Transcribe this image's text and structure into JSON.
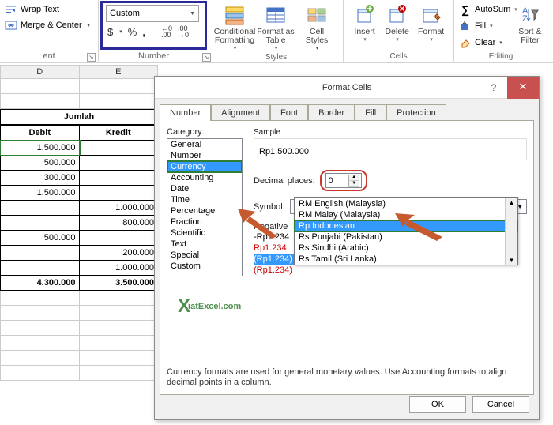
{
  "ribbon": {
    "alignment": {
      "wrap": "Wrap Text",
      "merge": "Merge & Center",
      "group": "ent"
    },
    "number": {
      "format": "Custom",
      "group": "Number",
      "btns": {
        "dollar": "$",
        "percent": "%",
        "comma": ",",
        "inc": "←0\n.00",
        "dec": ".00\n→0"
      }
    },
    "styles": {
      "cond": "Conditional\nFormatting",
      "table": "Format as\nTable",
      "cell": "Cell\nStyles",
      "group": "Styles"
    },
    "cells": {
      "insert": "Insert",
      "delete": "Delete",
      "format": "Format",
      "group": "Cells"
    },
    "editing": {
      "sum": "AutoSum",
      "fill": "Fill",
      "clear": "Clear",
      "sort": "Sort &\nFilter",
      "group": "Editing"
    }
  },
  "sheet": {
    "cols": [
      "D",
      "E"
    ],
    "header1": "Jumlah",
    "header2": [
      "Debit",
      "Kredit"
    ],
    "rows": [
      [
        "1.500.000",
        ""
      ],
      [
        "500.000",
        ""
      ],
      [
        "300.000",
        ""
      ],
      [
        "1.500.000",
        ""
      ],
      [
        "",
        "1.000.000"
      ],
      [
        "",
        "800.000"
      ],
      [
        "500.000",
        ""
      ],
      [
        "",
        "200.000"
      ],
      [
        "",
        "1.000.000"
      ]
    ],
    "totals": [
      "4.300.000",
      "3.500.000"
    ]
  },
  "dialog": {
    "title": "Format Cells",
    "tabs": [
      "Number",
      "Alignment",
      "Font",
      "Border",
      "Fill",
      "Protection"
    ],
    "cat_label": "Category:",
    "categories": [
      "General",
      "Number",
      "Currency",
      "Accounting",
      "Date",
      "Time",
      "Percentage",
      "Fraction",
      "Scientific",
      "Text",
      "Special",
      "Custom"
    ],
    "cat_selected": "Currency",
    "sample_label": "Sample",
    "sample_value": "Rp1.500.000",
    "decimal_label": "Decimal places:",
    "decimal_value": "0",
    "symbol_label": "Symbol:",
    "symbol_value": "Rp Indonesian",
    "neg_label": "Negative",
    "neg_items": [
      "-Rp1.234",
      "Rp1.234",
      "(Rp1.234)",
      "(Rp1.234)"
    ],
    "symbol_options": [
      "RM English (Malaysia)",
      "RM Malay (Malaysia)",
      "Rp Indonesian",
      "Rs Punjabi (Pakistan)",
      "Rs Sindhi (Arabic)",
      "Rs Tamil (Sri Lanka)"
    ],
    "desc": "Currency formats are used for general monetary values.  Use Accounting formats to align decimal points in a column.",
    "ok": "OK",
    "cancel": "Cancel"
  },
  "watermark": "iatExcel.com"
}
